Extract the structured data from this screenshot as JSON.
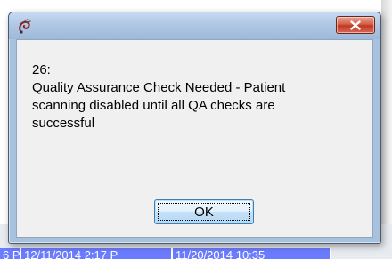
{
  "dialog": {
    "app_icon": "swirl-app-icon",
    "close_icon": "close-x-icon",
    "message_lines": [
      "26:",
      "Quality Assurance Check Needed - Patient",
      "scanning disabled until all QA checks are",
      "successful"
    ],
    "ok_label": "OK"
  },
  "background": {
    "row_cells": [
      "6 P",
      "12/11/2014 2:17 P",
      "11/20/2014 10:35"
    ],
    "side_ticks": [
      "o",
      "o"
    ]
  },
  "colors": {
    "selection_blue": "#6b7cff",
    "close_red": "#c2381f",
    "title_blue": "#aec6e2"
  }
}
